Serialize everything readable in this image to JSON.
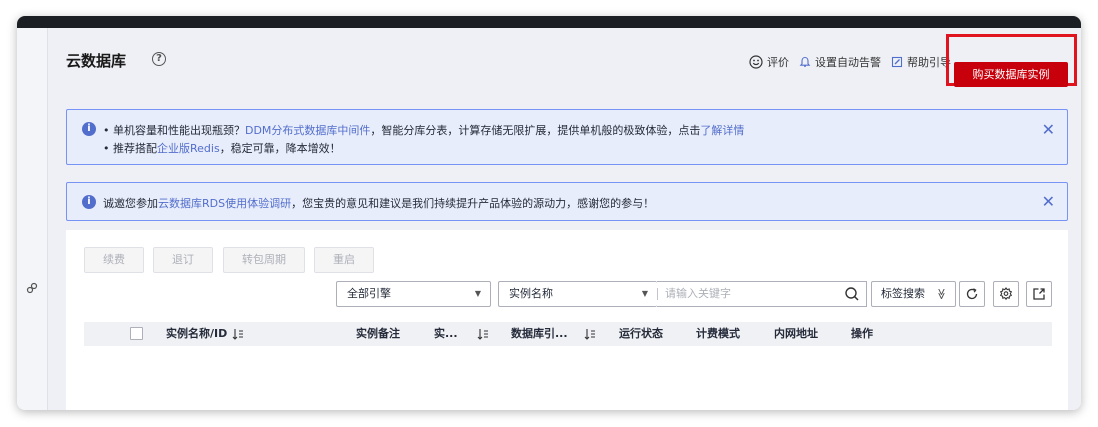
{
  "page": {
    "title": "云数据库",
    "help_icon_glyph": "?"
  },
  "header": {
    "actions": [
      {
        "icon": "smile-icon",
        "label": "评价"
      },
      {
        "icon": "bell-icon",
        "label": "设置自动告警"
      },
      {
        "icon": "edit-icon",
        "label": "帮助引导"
      }
    ],
    "buy_button": "购买数据库实例",
    "buy_button_color": "#c7000b",
    "highlight_color": "#e0141e"
  },
  "notice1": {
    "line1_prefix": "• 单机容量和性能出现瓶颈？",
    "line1_link": "DDM分布式数据库中间件",
    "line1_middle": "，智能分库分表，计算存储无限扩展，提供单机般的极致体验，点击",
    "line1_link2": "了解详情",
    "line2_prefix": "• 推荐搭配",
    "line2_link": "企业版Redis",
    "line2_suffix": "，稳定可靠，降本增效！",
    "close": "✕"
  },
  "notice2": {
    "prefix": "诚邀您参加",
    "link": "云数据库RDS使用体验调研",
    "suffix": "，您宝贵的意见和建议是我们持续提升产品体验的源动力，感谢您的参与！",
    "close": "✕"
  },
  "toolbar": {
    "renew": "续费",
    "unsubscribe": "退订",
    "to_yearly": "转包周期",
    "restart": "重启"
  },
  "filters": {
    "engine_select": "全部引擎",
    "field_select": "实例名称",
    "search_placeholder": "请输入关键字",
    "tag_search": "标签搜索",
    "tag_search_chevron": "≫"
  },
  "table": {
    "columns": [
      "实例名称/ID",
      "实例备注",
      "实...",
      "数据库引...",
      "运行状态",
      "计费模式",
      "内网地址",
      "操作"
    ]
  },
  "colors": {
    "notice_link": "#526ecc",
    "notice_bg": "#e8edfb",
    "notice_border": "#7693f5"
  }
}
